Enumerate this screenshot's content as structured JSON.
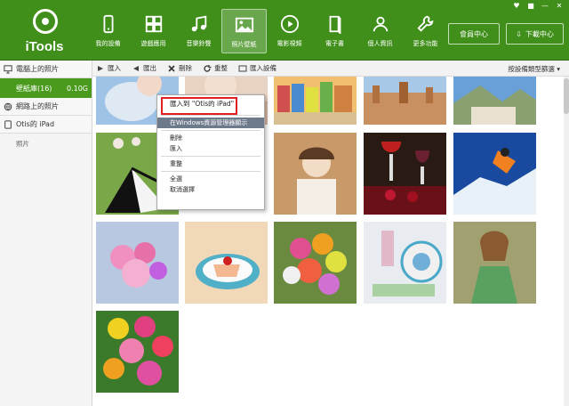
{
  "window": {
    "controls": [
      "♥",
      "■",
      "—",
      "✕"
    ]
  },
  "header": {
    "logo_text": "iTools",
    "nav": [
      {
        "label": "我的設備",
        "icon": "phone-icon"
      },
      {
        "label": "遊戲應用",
        "icon": "apps-icon"
      },
      {
        "label": "音樂鈴聲",
        "icon": "music-icon"
      },
      {
        "label": "照片壁紙",
        "icon": "photo-icon",
        "active": true
      },
      {
        "label": "電影視頻",
        "icon": "play-icon"
      },
      {
        "label": "電子書",
        "icon": "book-icon"
      },
      {
        "label": "個人資訊",
        "icon": "person-icon"
      },
      {
        "label": "更多功能",
        "icon": "wrench-icon"
      }
    ],
    "member_label": "會員中心",
    "download_label": "下載中心"
  },
  "sidebar": {
    "computer_photos": "電腦上的照片",
    "wallpaper_library": "壁紙庫(16)",
    "wallpaper_size": "0.10G",
    "web_photos": "網路上的照片",
    "device_name": "Otis的 iPad",
    "device_photos": "照片"
  },
  "toolbar": {
    "import": "匯入",
    "export": "匯出",
    "delete": "刪除",
    "refresh": "重整",
    "import_device": "匯入設備",
    "sort": "按設備類型篩選 ▾"
  },
  "context_menu": {
    "import_to": "匯入到 \"Otis的 iPad\"",
    "show_in_explorer": "在Windows資源管理器顯示",
    "delete": "刪除",
    "import": "匯入",
    "refresh": "重整",
    "select_all": "全選",
    "deselect": "取消選擇"
  },
  "colors": {
    "header_green": "#3f8f1a",
    "selected_green": "#4a9a1e",
    "menu_highlight": "#6d7a8c",
    "callout_red": "#e02020"
  }
}
